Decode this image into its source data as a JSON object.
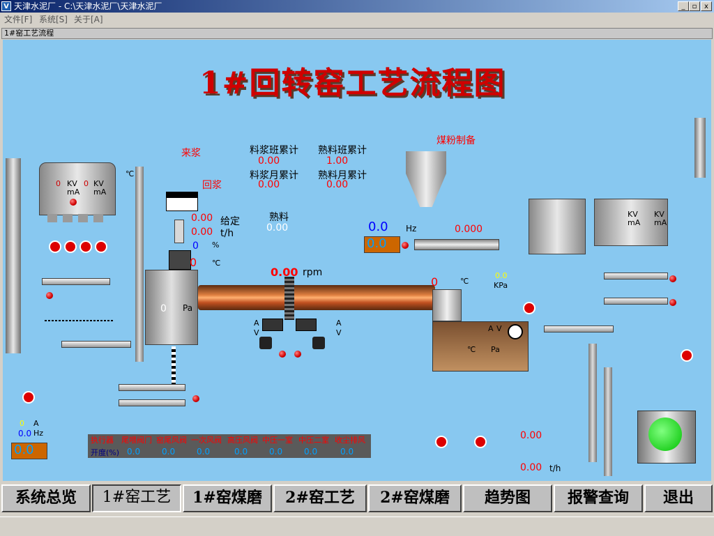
{
  "window": {
    "app_icon": "V",
    "title": "天津水泥厂 - C:\\天津水泥厂\\天津水泥厂",
    "minimize": "_",
    "restore": "▫",
    "close": "x"
  },
  "menu": [
    "文件[F]",
    "系统[S]",
    "关于[A]"
  ],
  "child_window_title": "1#窑工艺流程",
  "diagram": {
    "title": "1#回转窑工艺流程图",
    "labels": {
      "lai_jiang": "来浆",
      "hui_jiang": "回浆",
      "meifen": "煤粉制备",
      "gei_ding": "给定",
      "tph": "t/h",
      "percent": "%",
      "celsius": "℃",
      "rpm": "rpm",
      "hz": "Hz",
      "kpa": "KPa",
      "pa": "Pa",
      "kv": "KV",
      "ma": "mA",
      "a": "A",
      "v": "V",
      "shu_liao": "熟料"
    },
    "counters": {
      "liao_jiang_ban": {
        "label": "料浆班累计",
        "value": "0.00"
      },
      "liao_jiang_yue": {
        "label": "料浆月累计",
        "value": "0.00"
      },
      "shu_liao_ban": {
        "label": "熟料班累计",
        "value": "1.00"
      },
      "shu_liao_yue": {
        "label": "熟料月累计",
        "value": "0.00"
      }
    },
    "values": {
      "feed_set_1": "0.00",
      "feed_set_2": "0.00",
      "feed_pct": "0",
      "kiln_tail_temp": "0",
      "kiln_speed": "0.00",
      "kiln_tail_pa": "0",
      "shu_liao_value": "0.00",
      "coal_hz": "0.0",
      "coal_hz_set": "0.0",
      "coal_flow": "0.000",
      "kiln_head_temp": "0",
      "kiln_head_kpa": "0.0",
      "fan_hz": "0.0",
      "fan_hz_set": "0.0",
      "esp_kv": "0",
      "esp_ma": "0",
      "zero": "0",
      "small_val": "0.00"
    },
    "valve_table": {
      "row1_header": "执行器",
      "actuators": [
        "尾喂阀门",
        "窑尾风阀",
        "一次风阀",
        "高压风阀",
        "中压一室",
        "中压二室",
        "收尘排风"
      ],
      "row2_header": "开度(%)",
      "openings": [
        "0.0",
        "0.0",
        "0.0",
        "0.0",
        "0.0",
        "0.0",
        "0.0"
      ]
    }
  },
  "nav": [
    {
      "label": "系统总览",
      "active": false
    },
    {
      "label": "1#窑工艺",
      "active": true
    },
    {
      "label": "1#窑煤磨",
      "active": false
    },
    {
      "label": "2#窑工艺",
      "active": false
    },
    {
      "label": "2#窑煤磨",
      "active": false
    },
    {
      "label": "趋势图",
      "active": false
    },
    {
      "label": "报警查询",
      "active": false
    },
    {
      "label": "退出",
      "active": false
    }
  ],
  "colors": {
    "canvas_bg": "#88c8f0",
    "title_text": "#d00000",
    "value_red": "#ff0000",
    "value_yellow": "#ffff00",
    "value_blue": "#0000ff"
  }
}
